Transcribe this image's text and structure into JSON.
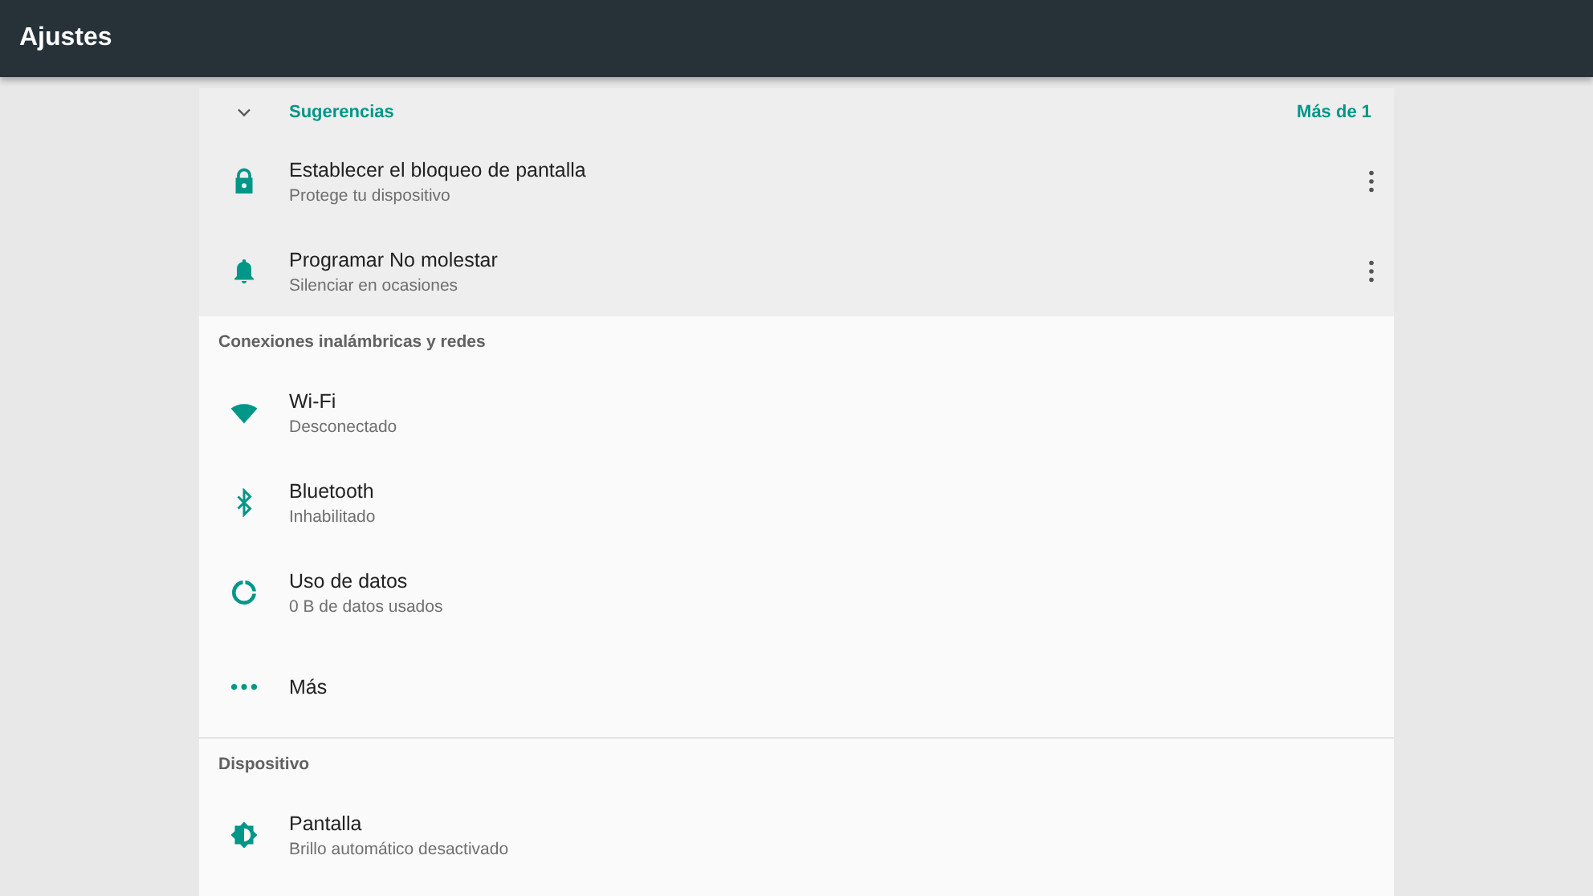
{
  "app_bar": {
    "title": "Ajustes"
  },
  "suggestions": {
    "title": "Sugerencias",
    "more": "Más de 1",
    "expanded": true,
    "items": [
      {
        "title": "Establecer el bloqueo de pantalla",
        "summary": "Protege tu dispositivo"
      },
      {
        "title": "Programar No molestar",
        "summary": "Silenciar en ocasiones"
      }
    ]
  },
  "sections": [
    {
      "title": "Conexiones inalámbricas y redes",
      "items": [
        {
          "title": "Wi-Fi",
          "summary": "Desconectado"
        },
        {
          "title": "Bluetooth",
          "summary": "Inhabilitado"
        },
        {
          "title": "Uso de datos",
          "summary": "0 B de datos usados"
        },
        {
          "title": "Más"
        }
      ]
    },
    {
      "title": "Dispositivo",
      "items": [
        {
          "title": "Pantalla",
          "summary": "Brillo automático desactivado"
        }
      ]
    }
  ]
}
